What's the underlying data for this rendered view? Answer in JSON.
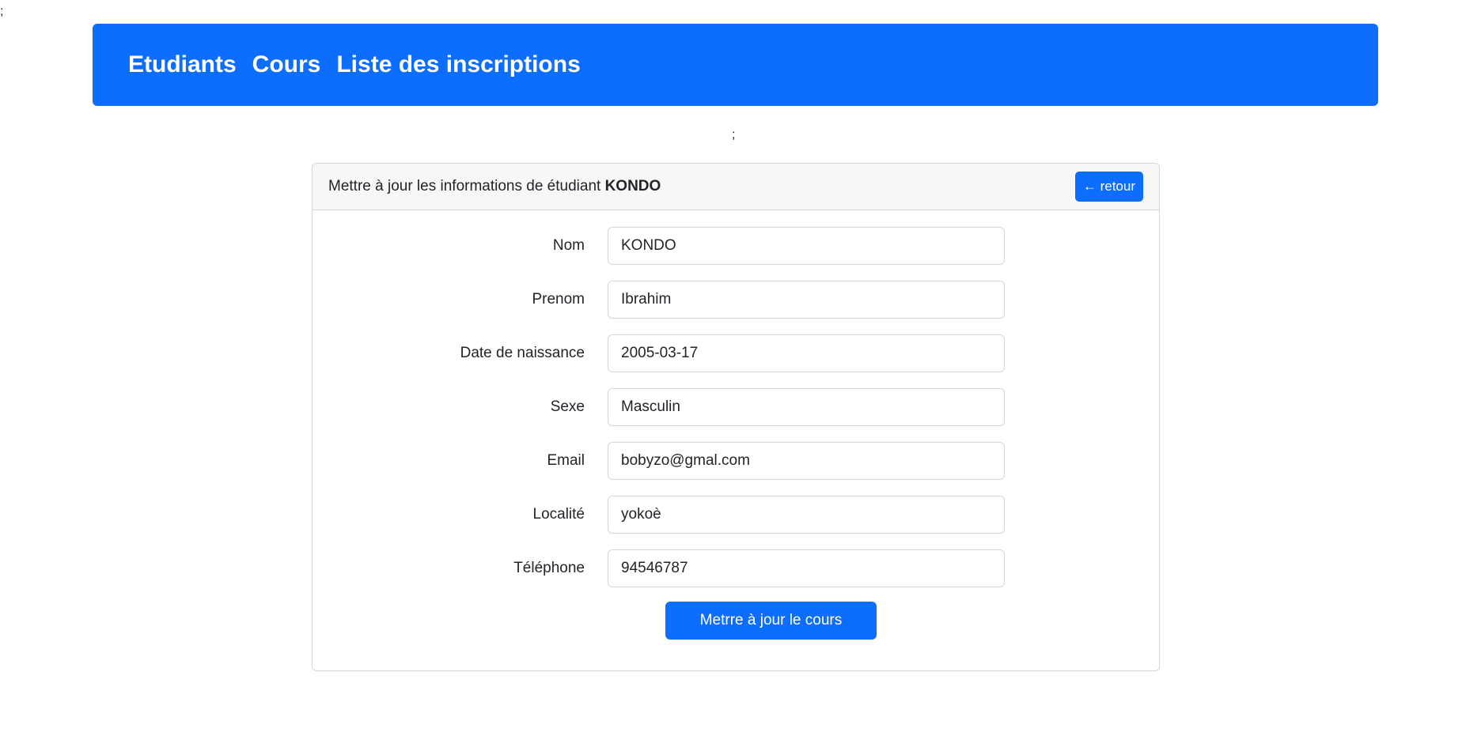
{
  "stray_text": {
    "top_left": ";",
    "center": ";"
  },
  "nav": {
    "items": [
      {
        "label": "Etudiants"
      },
      {
        "label": "Cours"
      },
      {
        "label": "Liste des inscriptions"
      }
    ]
  },
  "card": {
    "header_prefix": "Mettre à jour les informations de étudiant ",
    "student_name": "KONDO",
    "back_label": "← retour",
    "fields": [
      {
        "label": "Nom",
        "value": "KONDO"
      },
      {
        "label": "Prenom",
        "value": "Ibrahim"
      },
      {
        "label": "Date de naissance",
        "value": "2005-03-17"
      },
      {
        "label": "Sexe",
        "value": "Masculin"
      },
      {
        "label": "Email",
        "value": "bobyzo@gmal.com"
      },
      {
        "label": "Localité",
        "value": "yokoè"
      },
      {
        "label": "Téléphone",
        "value": "94546787"
      }
    ],
    "submit_label": "Metrre à jour le cours"
  },
  "colors": {
    "primary": "#0d6efd",
    "header_bg": "#f7f7f7",
    "border": "#d3d6da"
  }
}
